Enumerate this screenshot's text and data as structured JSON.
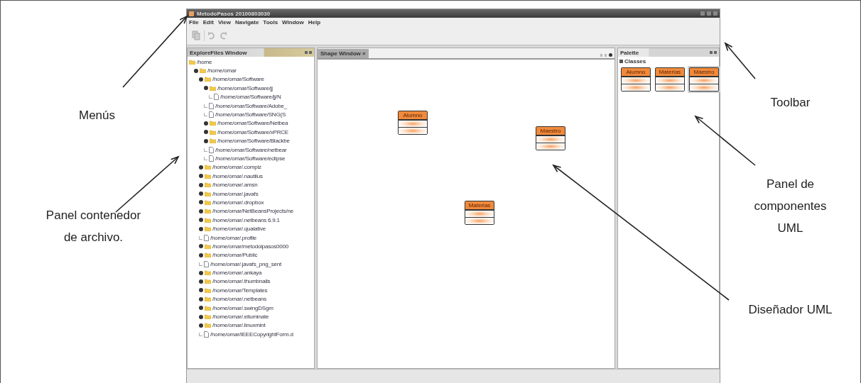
{
  "annotations": [
    {
      "text": "Menús"
    },
    {
      "text": "Panel contenedor de archivo."
    },
    {
      "text": "Toolbar"
    },
    {
      "text": "Panel de componentes UML"
    },
    {
      "text": "Diseñador UML"
    }
  ],
  "window": {
    "title": "MetodoPasos 20100803030"
  },
  "menu": [
    "File",
    "Edit",
    "View",
    "Navigate",
    "Tools",
    "Window",
    "Help"
  ],
  "explorer": {
    "title": "ExploreFiles Window",
    "tree": [
      {
        "label": "/home",
        "kind": "folder",
        "children": [
          {
            "label": "/home/omar",
            "kind": "folder",
            "children": [
              {
                "label": "/home/omar/Software",
                "kind": "folder",
                "children": [
                  {
                    "label": "/home/omar/Software/jj",
                    "kind": "folder",
                    "children": [
                      {
                        "label": "/home/omar/Software/jj/N",
                        "kind": "file"
                      }
                    ]
                  },
                  {
                    "label": "/home/omar/Software/Adobe_",
                    "kind": "file"
                  },
                  {
                    "label": "/home/omar/Software/SNG(S",
                    "kind": "file"
                  },
                  {
                    "label": "/home/omar/Software/Netbea",
                    "kind": "folder"
                  },
                  {
                    "label": "/home/omar/Software/xPRCE",
                    "kind": "folder"
                  },
                  {
                    "label": "/home/omar/Software/Blackbe",
                    "kind": "folder"
                  },
                  {
                    "label": "/home/omar/Software/netbear",
                    "kind": "file"
                  },
                  {
                    "label": "/home/omar/Software/eclipse",
                    "kind": "file"
                  }
                ]
              },
              {
                "label": "/home/omar/.compiz",
                "kind": "folder"
              },
              {
                "label": "/home/omar/.nautilus",
                "kind": "folder"
              },
              {
                "label": "/home/omar/.amsn",
                "kind": "folder"
              },
              {
                "label": "/home/omar/.javafs",
                "kind": "folder"
              },
              {
                "label": "/home/omar/.dropbox",
                "kind": "folder"
              },
              {
                "label": "/home/omar/NetBeansProjects/ne",
                "kind": "folder"
              },
              {
                "label": "/home/omar/.netbeans 6.9.1",
                "kind": "folder"
              },
              {
                "label": "/home/omar/.qualative",
                "kind": "folder"
              },
              {
                "label": "/home/omar/.profile",
                "kind": "file"
              },
              {
                "label": "/home/omar/metodolpasos0000",
                "kind": "folder"
              },
              {
                "label": "/home/omar/Public",
                "kind": "folder"
              },
              {
                "label": "/home/omar/.javafs_png_sent",
                "kind": "file"
              },
              {
                "label": "/home/omar/.ankaya",
                "kind": "folder"
              },
              {
                "label": "/home/omar/.thumbnails",
                "kind": "folder"
              },
              {
                "label": "/home/omar/Templates",
                "kind": "folder"
              },
              {
                "label": "/home/omar/.netbeans",
                "kind": "folder"
              },
              {
                "label": "/home/omar/.swingDSgm",
                "kind": "folder"
              },
              {
                "label": "/home/omar/.elluminate",
                "kind": "folder"
              },
              {
                "label": "/home/omar/.linuxmint",
                "kind": "folder"
              },
              {
                "label": "/home/omar/IEEECopyrightForm.d",
                "kind": "file"
              }
            ]
          }
        ]
      }
    ]
  },
  "designer": {
    "tab": "Shape Window",
    "tab_close": "×",
    "classes": [
      {
        "name": "Alumno"
      },
      {
        "name": "Maestro"
      },
      {
        "name": "Materias"
      }
    ]
  },
  "palette": {
    "title": "Palette",
    "category": "Classes",
    "items": [
      {
        "name": "Alumno",
        "selected": false
      },
      {
        "name": "Materias",
        "selected": false
      },
      {
        "name": "Maestro",
        "selected": true
      }
    ]
  }
}
